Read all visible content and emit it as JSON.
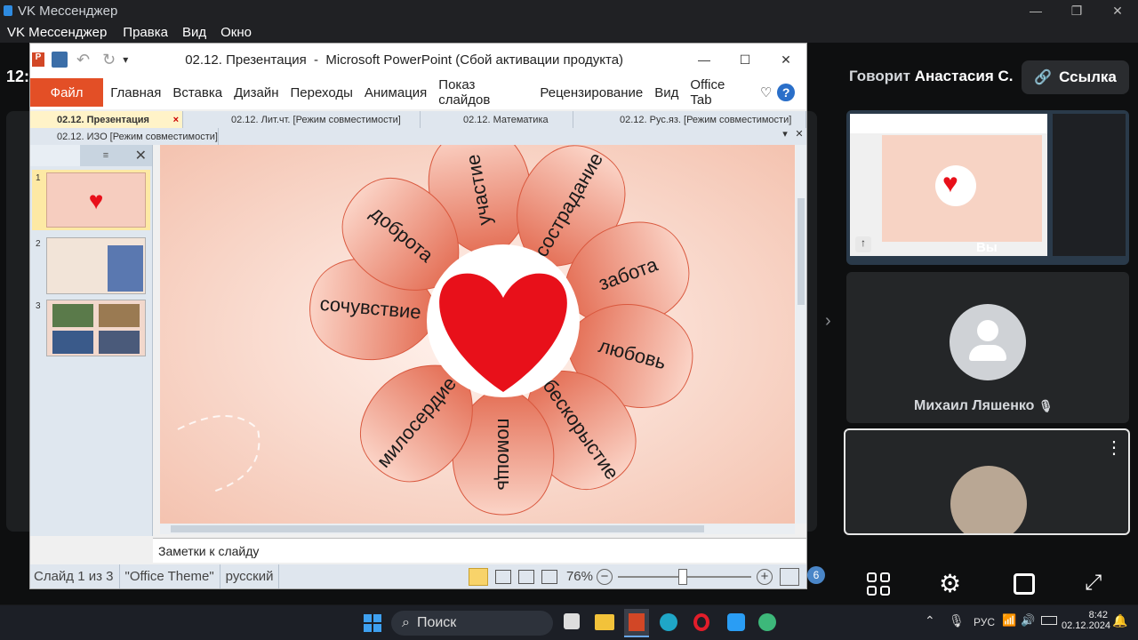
{
  "vk": {
    "title": "VK Мессенджер",
    "menu": [
      "VK Мессенджер",
      "Правка",
      "Вид",
      "Окно"
    ],
    "clock_partial": "12:",
    "speaker_prefix": "Говорит",
    "speaker_name": "Анастасия С.",
    "link_label": "Ссылка",
    "participant_name": "Михаил Ляшенко",
    "self_label": "Вы",
    "participants_count": "6"
  },
  "ppt": {
    "title": "02.12. Презентация  -  Microsoft PowerPoint (Сбой активации продукта)",
    "ribbon_tabs": [
      "Файл",
      "Главная",
      "Вставка",
      "Дизайн",
      "Переходы",
      "Анимация",
      "Показ слайдов",
      "Рецензирование",
      "Вид",
      "Office Tab"
    ],
    "doc_tabs_row1": [
      "02.12. Презентация",
      "02.12. Лит.чт. [Режим совместимости]",
      "02.12. Математика",
      "02.12. Рус.яз. [Режим совместимости]"
    ],
    "doc_tabs_row2": [
      "02.12. ИЗО [Режим совместимости]"
    ],
    "slide_numbers": [
      "1",
      "2",
      "3"
    ],
    "petals": [
      "участие",
      "сострадание",
      "забота",
      "любовь",
      "бескорыстие",
      "помощь",
      "милосердие",
      "сочувствие",
      "доброта"
    ],
    "notes_placeholder": "Заметки к слайду",
    "status": {
      "slide": "Слайд 1 из 3",
      "theme": "\"Office Theme\"",
      "lang": "русский",
      "zoom": "76%"
    }
  },
  "taskbar": {
    "search_label": "Поиск",
    "lang": "РУС",
    "time": "8:42",
    "date": "02.12.2024"
  },
  "colors": {
    "accent": "#e34f26",
    "heart": "#e8101a",
    "petal": "#e8735c"
  }
}
